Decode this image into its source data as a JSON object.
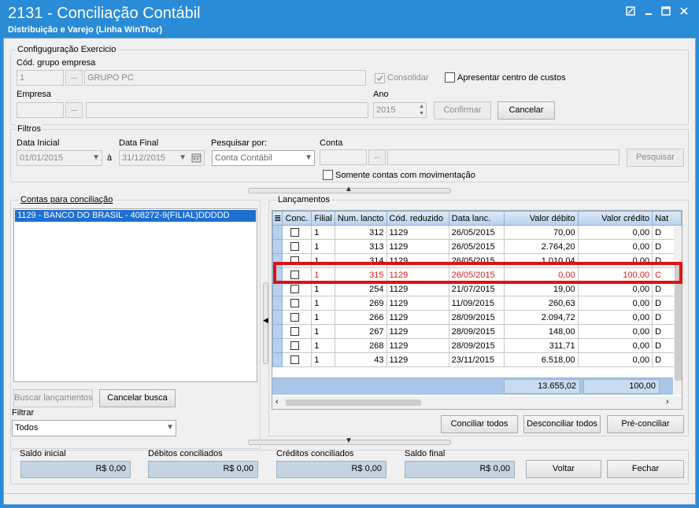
{
  "window": {
    "title": "2131 - Conciliação Contábil",
    "subtitle": "Distribuição e Varejo (Linha WinThor)"
  },
  "config": {
    "group_label": "Configuguração Exercicio",
    "cod_grupo_label": "Cód. grupo empresa",
    "cod_grupo_value": "1",
    "grupo_name_value": "GRUPO PC",
    "consolidar_label": "Consolidar",
    "consolidar_checked": true,
    "apresentar_label": "Apresentar centro de custos",
    "empresa_label": "Empresa",
    "empresa_value": "",
    "empresa_name_value": "",
    "ano_label": "Ano",
    "ano_value": "2015",
    "confirmar_label": "Confirmar",
    "cancelar_label": "Cancelar"
  },
  "filtros": {
    "group_label": "Filtros",
    "data_inicial_label": "Data Inicial",
    "data_inicial_value": "01/01/2015",
    "a_label": "à",
    "data_final_label": "Data Final",
    "data_final_value": "31/12/2015",
    "pesquisar_por_label": "Pesquisar por:",
    "pesquisar_por_value": "Conta Contábil",
    "conta_label": "Conta",
    "conta_value": "",
    "conta_name_value": "",
    "pesquisar_button": "Pesquisar",
    "somente_label": "Somente contas com movimentação"
  },
  "contas": {
    "group_label": "Contas para conciliação",
    "items": [
      "1129 - BANCO DO BRASIL - 408272-9(FILIAL)DDDDD"
    ],
    "buscar_button": "Buscar lançamentos",
    "cancelar_busca_button": "Cancelar busca",
    "filtrar_label": "Filtrar",
    "filtrar_value": "Todos"
  },
  "lancamentos": {
    "group_label": "Lançamentos",
    "columns": [
      "Conc.",
      "Filial",
      "Num. lancto",
      "Cód. reduzido",
      "Data lanc.",
      "Valor débito",
      "Valor crédito",
      "Nat"
    ],
    "rows": [
      {
        "filial": "1",
        "num": "312",
        "cod": "1129",
        "data": "26/05/2015",
        "debito": "70,00",
        "credito": "0,00",
        "nat": "D"
      },
      {
        "filial": "1",
        "num": "313",
        "cod": "1129",
        "data": "26/05/2015",
        "debito": "2.764,20",
        "credito": "0,00",
        "nat": "D"
      },
      {
        "filial": "1",
        "num": "314",
        "cod": "1129",
        "data": "26/05/2015",
        "debito": "1.010,04",
        "credito": "0,00",
        "nat": "D"
      },
      {
        "filial": "1",
        "num": "315",
        "cod": "1129",
        "data": "26/05/2015",
        "debito": "0,00",
        "credito": "100,00",
        "nat": "C"
      },
      {
        "filial": "1",
        "num": "254",
        "cod": "1129",
        "data": "21/07/2015",
        "debito": "19,00",
        "credito": "0,00",
        "nat": "D"
      },
      {
        "filial": "1",
        "num": "269",
        "cod": "1129",
        "data": "11/09/2015",
        "debito": "260,63",
        "credito": "0,00",
        "nat": "D"
      },
      {
        "filial": "1",
        "num": "266",
        "cod": "1129",
        "data": "28/09/2015",
        "debito": "2.094,72",
        "credito": "0,00",
        "nat": "D"
      },
      {
        "filial": "1",
        "num": "267",
        "cod": "1129",
        "data": "28/09/2015",
        "debito": "148,00",
        "credito": "0,00",
        "nat": "D"
      },
      {
        "filial": "1",
        "num": "268",
        "cod": "1129",
        "data": "28/09/2015",
        "debito": "311,71",
        "credito": "0,00",
        "nat": "D"
      },
      {
        "filial": "1",
        "num": "43",
        "cod": "1129",
        "data": "23/11/2015",
        "debito": "6.518,00",
        "credito": "0,00",
        "nat": "D"
      }
    ],
    "total_debito": "13.655,02",
    "total_credito": "100,00",
    "conciliar_todos": "Conciliar todos",
    "desconciliar_todos": "Desconciliar todos",
    "pre_conciliar": "Pré-conciliar"
  },
  "rodape": {
    "saldo_inicial_label": "Saldo inicial",
    "saldo_inicial_value": "R$ 0,00",
    "debitos_label": "Débitos conciliados",
    "debitos_value": "R$ 0,00",
    "creditos_label": "Créditos conciliados",
    "creditos_value": "R$ 0,00",
    "saldo_final_label": "Saldo final",
    "saldo_final_value": "R$ 0,00",
    "voltar_button": "Voltar",
    "fechar_button": "Fechar"
  },
  "icons": {
    "restore": "restore-icon",
    "minimize": "minimize-icon",
    "maximize": "maximize-icon",
    "close": "close-icon",
    "calendar": "calendar-icon"
  },
  "colors": {
    "titlebar": "#2a8bd6",
    "highlight_border": "#e31010",
    "red_row_text": "#e0201e",
    "selected_item": "#1f6fd1"
  }
}
